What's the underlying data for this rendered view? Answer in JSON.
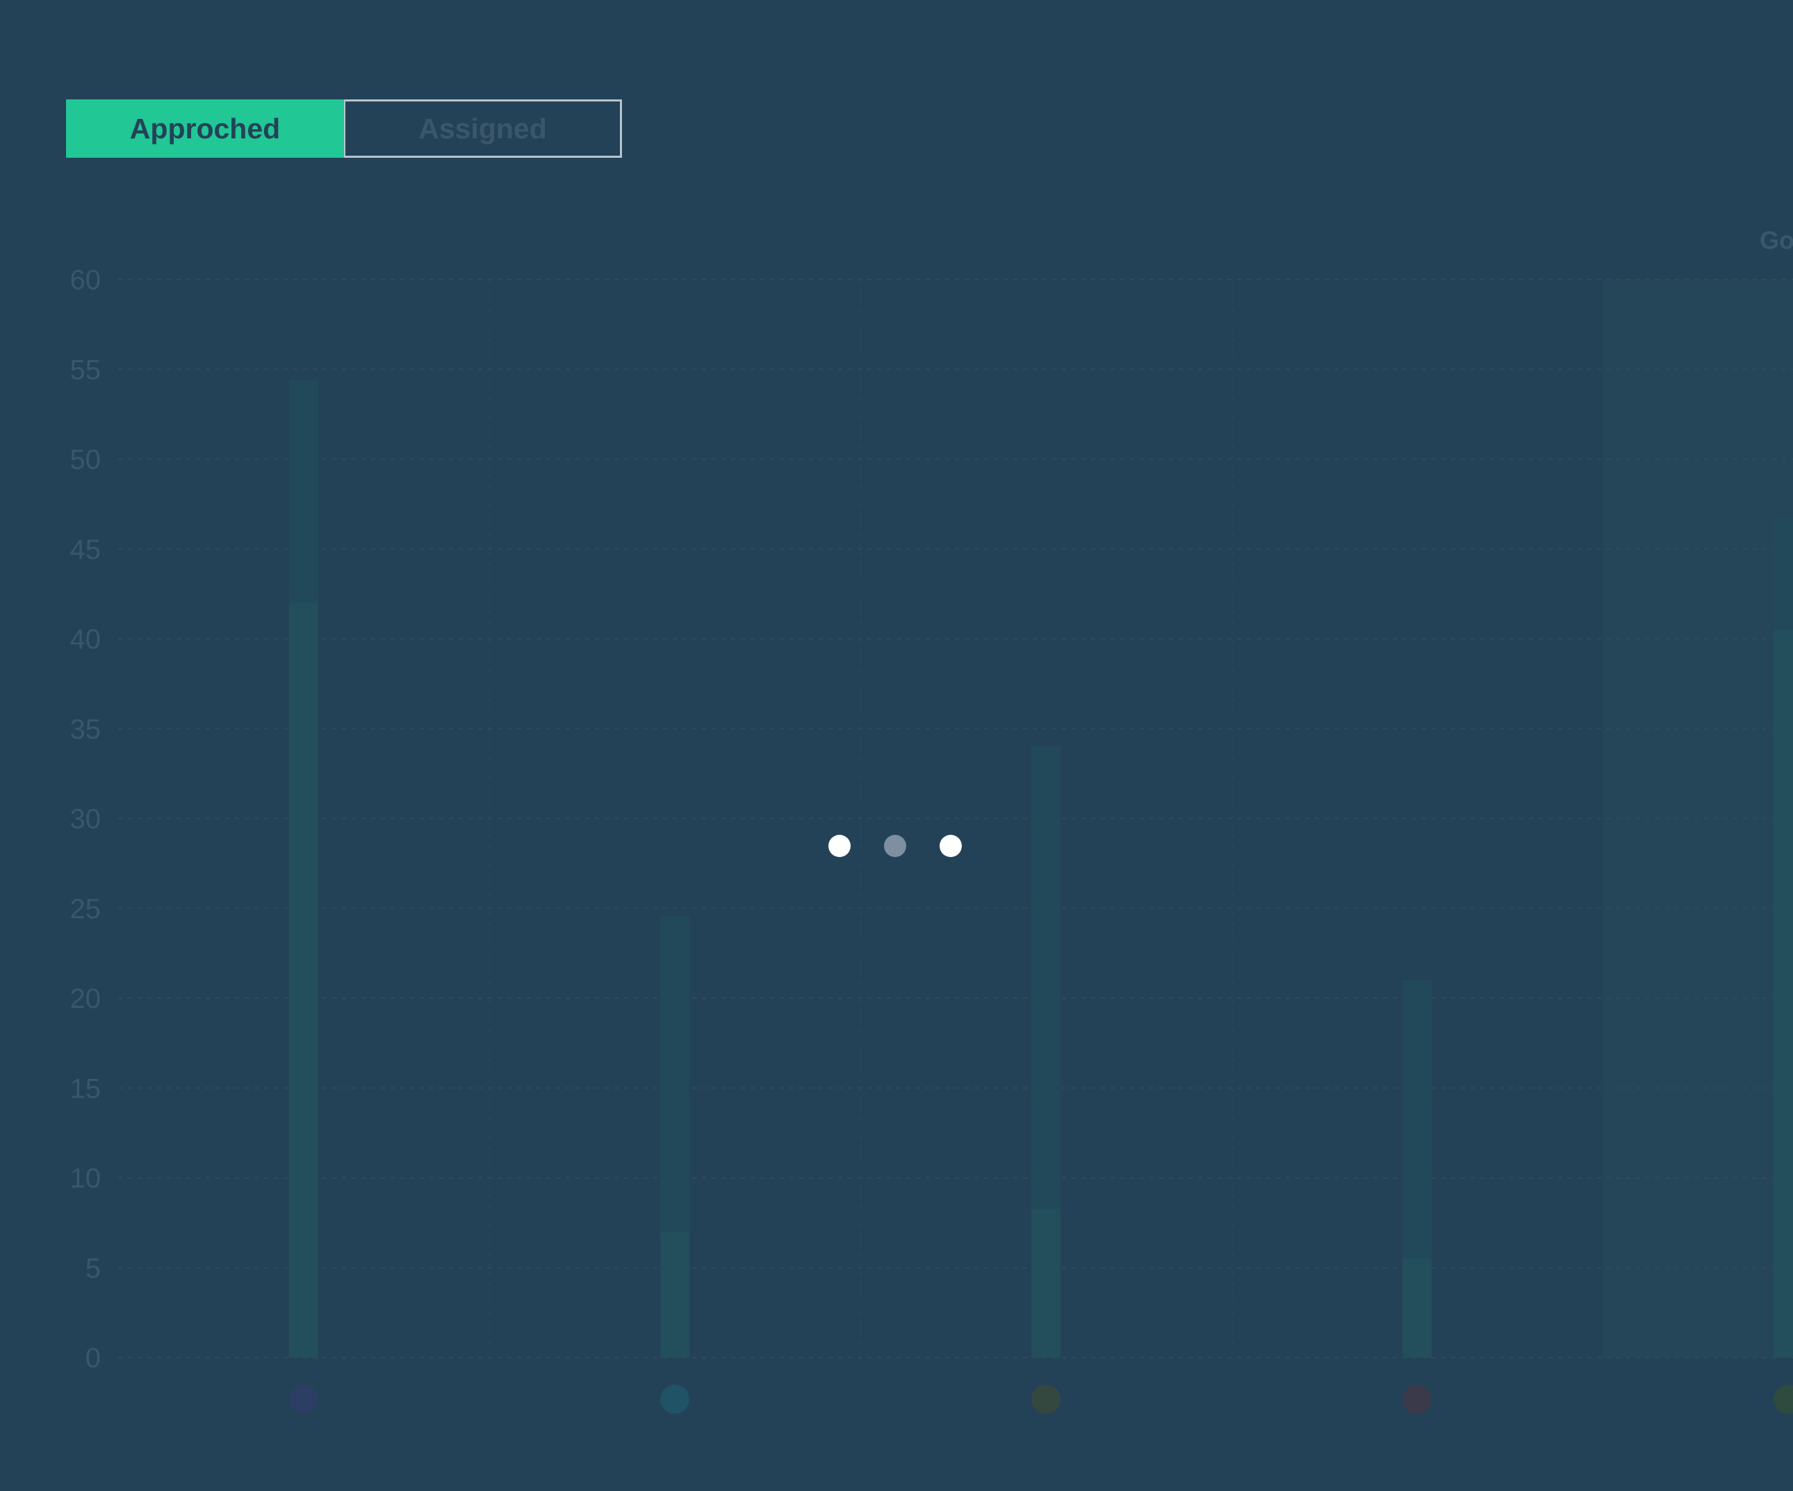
{
  "tabs": [
    {
      "label": "Approched",
      "active": true
    },
    {
      "label": "Assigned",
      "active": false
    }
  ],
  "chart_data": {
    "type": "bar",
    "stacked": true,
    "ylim": [
      0,
      60
    ],
    "yticks": [
      0,
      5,
      10,
      15,
      20,
      25,
      30,
      35,
      40,
      45,
      50,
      55,
      60
    ],
    "grid": true,
    "categories": [
      "",
      "",
      "",
      "",
      "Go"
    ],
    "category_dot_colors": [
      "#2c3e63",
      "#1f5365",
      "#34483f",
      "#3b3a4a",
      "#2f4a3e"
    ],
    "series": [
      {
        "values": [
          42,
          7,
          8.3,
          5.5,
          40.5
        ],
        "color": "#234e5c"
      },
      {
        "values": [
          12.4,
          17.6,
          25.7,
          15.5,
          6.3
        ],
        "color": "#22495a"
      }
    ],
    "highlight_band": {
      "category_index": 4,
      "color": "#254558"
    }
  },
  "loader": {
    "dot_colors": [
      "#ffffff",
      "#7d8fa0",
      "#ffffff"
    ]
  },
  "colors": {
    "background": "#244257",
    "accent": "#21c795",
    "axis_text": "#3a566b",
    "grid": "#2f4b60"
  }
}
